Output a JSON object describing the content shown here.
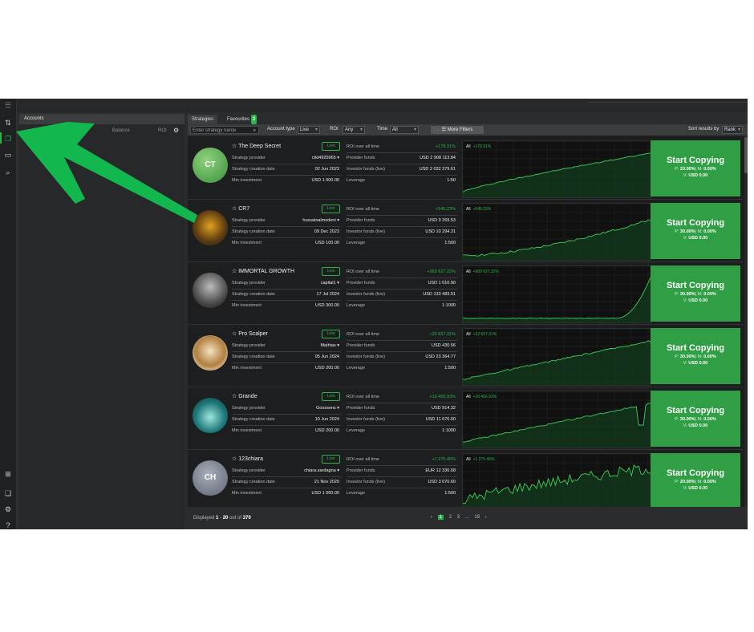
{
  "colors": {
    "accent": "#2db34a",
    "copy_button": "#2f9e44",
    "background": "#2a2c2e",
    "arrow": "#12b84e"
  },
  "sidebar": {
    "icons": [
      "menu-icon",
      "strategies-icon",
      "copy-icon",
      "wallet-icon",
      "search-analytics-icon",
      "gift-icon",
      "docs-icon",
      "settings-icon",
      "help-icon"
    ]
  },
  "accounts": {
    "title": "Accounts",
    "col_balance": "Balance",
    "col_roi": "ROI"
  },
  "tabs": [
    {
      "label": "Strategies"
    },
    {
      "label": "Favourites",
      "count": "3"
    }
  ],
  "filters": {
    "search_placeholder": "Enter strategy name",
    "account_type_label": "Account type",
    "account_type_value": "Live",
    "roi_label": "ROI",
    "roi_value": "Any",
    "time_label": "Time",
    "time_value": "All",
    "more_filters": "More Filters",
    "sort_label": "Sort results by",
    "sort_value": "Rank"
  },
  "labels": {
    "strategy_provider": "Strategy provider",
    "strategy_creation_date": "Strategy creation date",
    "min_investment": "Min investment",
    "roi_over_all_time": "ROI over all time",
    "provider_funds": "Provider funds",
    "investor_funds": "Investor funds (live)",
    "leverage": "Leverage",
    "live": "Live",
    "start_copying": "Start Copying",
    "all": "All"
  },
  "strategies": [
    {
      "name": "The Deep Secret",
      "initials": "CT",
      "provider": "ctid4925965",
      "created": "02 Jun 2023",
      "min_investment": "USD 1 000.00",
      "roi": "+178.91%",
      "provider_funds": "USD 2 908 113.84",
      "investor_funds": "USD 2 032 379.61",
      "leverage": "1:50",
      "fees": {
        "p": "20.00%",
        "m": "0.00%",
        "v": "USD 0.00"
      },
      "chart_shape": "smooth"
    },
    {
      "name": "CR7",
      "initials": "",
      "provider": "hussainalmodeni",
      "created": "09 Dec 2023",
      "min_investment": "USD 100.00",
      "roi": "+545.23%",
      "provider_funds": "USD 9 269.53",
      "investor_funds": "USD 10 294.31",
      "leverage": "1:500",
      "fees": {
        "p": "30.00%",
        "m": "0.00%",
        "v": "USD 0.00"
      },
      "chart_shape": "rising"
    },
    {
      "name": "IMMORTAL GROWTH",
      "initials": "",
      "provider": "capital1",
      "created": "17 Jul 2024",
      "min_investment": "USD 300.00",
      "roi": "+960 627.22%",
      "provider_funds": "USD 1 010.90",
      "investor_funds": "USD 133 483.51",
      "leverage": "1:1000",
      "fees": {
        "p": "30.00%",
        "m": "0.00%",
        "v": "USD 0.00"
      },
      "chart_shape": "hockey"
    },
    {
      "name": "Pro Scalper",
      "initials": "",
      "provider": "Mathias",
      "created": "05 Jun 2024",
      "min_investment": "USD 200.00",
      "roi": "+22 657.31%",
      "provider_funds": "USD 430.56",
      "investor_funds": "USD 23 364.77",
      "leverage": "1:500",
      "fees": {
        "p": "30.00%",
        "m": "0.00%",
        "v": "USD 0.00"
      },
      "chart_shape": "steady"
    },
    {
      "name": "Grande",
      "initials": "",
      "provider": "Goossens",
      "created": "10 Jun 2024",
      "min_investment": "USD 200.00",
      "roi": "+16 456.93%",
      "provider_funds": "USD 914.32",
      "investor_funds": "USD 11 676.60",
      "leverage": "1:1000",
      "fees": {
        "p": "30.00%",
        "m": "0.00%",
        "v": "USD 0.00"
      },
      "chart_shape": "steady_dip"
    },
    {
      "name": "123chiara",
      "initials": "CH",
      "provider": "chiara.sardagna",
      "created": "21 Nov 2020",
      "min_investment": "USD 1 060.00",
      "roi": "+1 275.45%",
      "provider_funds": "EUR 12 336.68",
      "investor_funds": "USD 3 070.60",
      "leverage": "1:500",
      "fees": {
        "p": "20.00%",
        "m": "0.00%",
        "v": "USD 0.00"
      },
      "chart_shape": "volatile"
    }
  ],
  "footer": {
    "displayed": "Displayed",
    "from": "1",
    "dash": "-",
    "to": "20",
    "out_of": "out of",
    "total": "370",
    "pages": [
      "‹",
      "1",
      "2",
      "3",
      "...",
      "19",
      "›"
    ]
  }
}
